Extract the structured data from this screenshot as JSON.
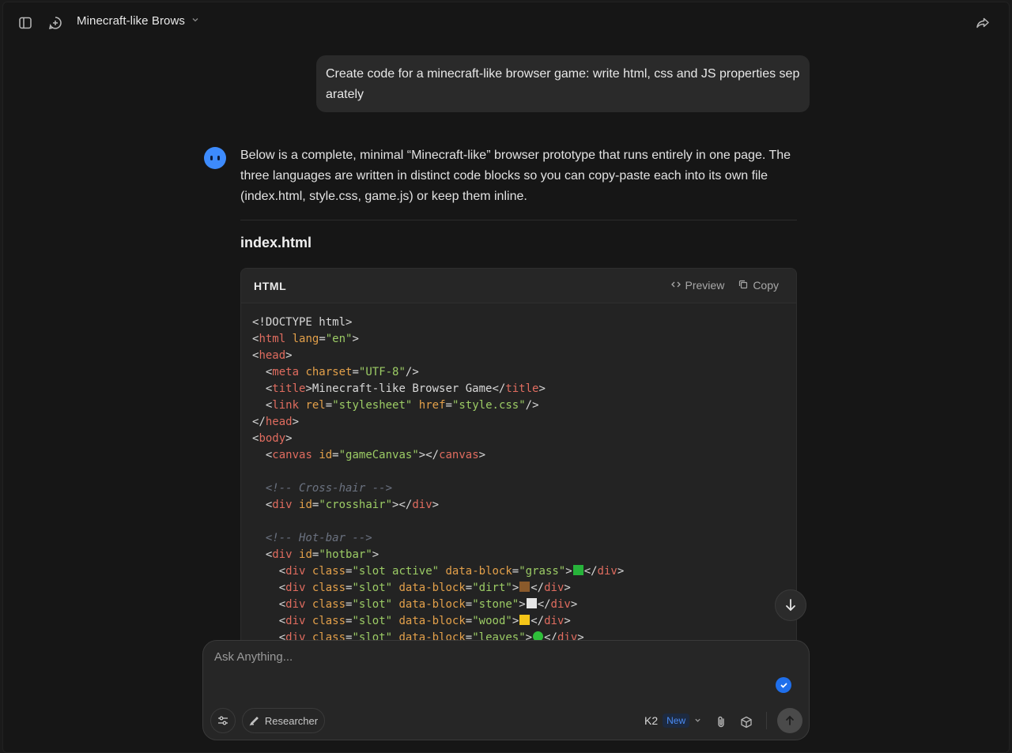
{
  "header": {
    "title": "Minecraft-like Brows",
    "sidebar_toggle_icon": "sidebar-toggle-icon",
    "new_chat_icon": "new-chat-icon",
    "share_icon": "share-icon"
  },
  "conversation": {
    "user_message": "Create code for a minecraft-like browser game: write html, css and JS properties separately",
    "assistant_intro": "Below is a complete, minimal “Minecraft-like” browser prototype that runs entirely in one page. The three languages are written in distinct code blocks so you can copy-paste each into its own file (index.html, style.css, game.js) or keep them inline.",
    "section_heading": "index.html"
  },
  "code_block": {
    "language": "HTML",
    "preview_label": "Preview",
    "copy_label": "Copy",
    "lines": [
      [
        [
          "pun",
          "<!DOCTYPE html>"
        ]
      ],
      [
        [
          "pun",
          "<"
        ],
        [
          "tag",
          "html"
        ],
        [
          "pun",
          " "
        ],
        [
          "attr",
          "lang"
        ],
        [
          "pun",
          "="
        ],
        [
          "str",
          "\"en\""
        ],
        [
          "pun",
          ">"
        ]
      ],
      [
        [
          "pun",
          "<"
        ],
        [
          "tag",
          "head"
        ],
        [
          "pun",
          ">"
        ]
      ],
      [
        [
          "pun",
          "  <"
        ],
        [
          "tag",
          "meta"
        ],
        [
          "pun",
          " "
        ],
        [
          "attr",
          "charset"
        ],
        [
          "pun",
          "="
        ],
        [
          "str",
          "\"UTF-8\""
        ],
        [
          "pun",
          "/>"
        ]
      ],
      [
        [
          "pun",
          "  <"
        ],
        [
          "tag",
          "title"
        ],
        [
          "pun",
          ">Minecraft-like Browser Game</"
        ],
        [
          "tag",
          "title"
        ],
        [
          "pun",
          ">"
        ]
      ],
      [
        [
          "pun",
          "  <"
        ],
        [
          "tag",
          "link"
        ],
        [
          "pun",
          " "
        ],
        [
          "attr",
          "rel"
        ],
        [
          "pun",
          "="
        ],
        [
          "str",
          "\"stylesheet\""
        ],
        [
          "pun",
          " "
        ],
        [
          "attr",
          "href"
        ],
        [
          "pun",
          "="
        ],
        [
          "str",
          "\"style.css\""
        ],
        [
          "pun",
          "/>"
        ]
      ],
      [
        [
          "pun",
          "</"
        ],
        [
          "tag",
          "head"
        ],
        [
          "pun",
          ">"
        ]
      ],
      [
        [
          "pun",
          "<"
        ],
        [
          "tag",
          "body"
        ],
        [
          "pun",
          ">"
        ]
      ],
      [
        [
          "pun",
          "  <"
        ],
        [
          "tag",
          "canvas"
        ],
        [
          "pun",
          " "
        ],
        [
          "attr",
          "id"
        ],
        [
          "pun",
          "="
        ],
        [
          "str",
          "\"gameCanvas\""
        ],
        [
          "pun",
          "></"
        ],
        [
          "tag",
          "canvas"
        ],
        [
          "pun",
          ">"
        ]
      ],
      [
        [
          "pun",
          ""
        ]
      ],
      [
        [
          "com",
          "  <!-- Cross-hair -->"
        ]
      ],
      [
        [
          "pun",
          "  <"
        ],
        [
          "tag",
          "div"
        ],
        [
          "pun",
          " "
        ],
        [
          "attr",
          "id"
        ],
        [
          "pun",
          "="
        ],
        [
          "str",
          "\"crosshair\""
        ],
        [
          "pun",
          "></"
        ],
        [
          "tag",
          "div"
        ],
        [
          "pun",
          ">"
        ]
      ],
      [
        [
          "pun",
          ""
        ]
      ],
      [
        [
          "com",
          "  <!-- Hot-bar -->"
        ]
      ],
      [
        [
          "pun",
          "  <"
        ],
        [
          "tag",
          "div"
        ],
        [
          "pun",
          " "
        ],
        [
          "attr",
          "id"
        ],
        [
          "pun",
          "="
        ],
        [
          "str",
          "\"hotbar\""
        ],
        [
          "pun",
          ">"
        ]
      ],
      [
        [
          "pun",
          "    <"
        ],
        [
          "tag",
          "div"
        ],
        [
          "pun",
          " "
        ],
        [
          "attr",
          "class"
        ],
        [
          "pun",
          "="
        ],
        [
          "str",
          "\"slot active\""
        ],
        [
          "pun",
          " "
        ],
        [
          "attr",
          "data-block"
        ],
        [
          "pun",
          "="
        ],
        [
          "str",
          "\"grass\""
        ],
        [
          "pun",
          ">"
        ],
        [
          "sq",
          "#27b33a"
        ],
        [
          "pun",
          "</"
        ],
        [
          "tag",
          "div"
        ],
        [
          "pun",
          ">"
        ]
      ],
      [
        [
          "pun",
          "    <"
        ],
        [
          "tag",
          "div"
        ],
        [
          "pun",
          " "
        ],
        [
          "attr",
          "class"
        ],
        [
          "pun",
          "="
        ],
        [
          "str",
          "\"slot\""
        ],
        [
          "pun",
          " "
        ],
        [
          "attr",
          "data-block"
        ],
        [
          "pun",
          "="
        ],
        [
          "str",
          "\"dirt\""
        ],
        [
          "pun",
          ">"
        ],
        [
          "sq",
          "#8a5a2b"
        ],
        [
          "pun",
          "</"
        ],
        [
          "tag",
          "div"
        ],
        [
          "pun",
          ">"
        ]
      ],
      [
        [
          "pun",
          "    <"
        ],
        [
          "tag",
          "div"
        ],
        [
          "pun",
          " "
        ],
        [
          "attr",
          "class"
        ],
        [
          "pun",
          "="
        ],
        [
          "str",
          "\"slot\""
        ],
        [
          "pun",
          " "
        ],
        [
          "attr",
          "data-block"
        ],
        [
          "pun",
          "="
        ],
        [
          "str",
          "\"stone\""
        ],
        [
          "pun",
          ">"
        ],
        [
          "sq",
          "#e6e6e6"
        ],
        [
          "pun",
          "</"
        ],
        [
          "tag",
          "div"
        ],
        [
          "pun",
          ">"
        ]
      ],
      [
        [
          "pun",
          "    <"
        ],
        [
          "tag",
          "div"
        ],
        [
          "pun",
          " "
        ],
        [
          "attr",
          "class"
        ],
        [
          "pun",
          "="
        ],
        [
          "str",
          "\"slot\""
        ],
        [
          "pun",
          " "
        ],
        [
          "attr",
          "data-block"
        ],
        [
          "pun",
          "="
        ],
        [
          "str",
          "\"wood\""
        ],
        [
          "pun",
          ">"
        ],
        [
          "sq",
          "#f5c518"
        ],
        [
          "pun",
          "</"
        ],
        [
          "tag",
          "div"
        ],
        [
          "pun",
          ">"
        ]
      ],
      [
        [
          "pun",
          "    <"
        ],
        [
          "tag",
          "div"
        ],
        [
          "pun",
          " "
        ],
        [
          "attr",
          "class"
        ],
        [
          "pun",
          "="
        ],
        [
          "str",
          "\"slot\""
        ],
        [
          "pun",
          " "
        ],
        [
          "attr",
          "data-block"
        ],
        [
          "pun",
          "="
        ],
        [
          "str",
          "\"leaves\""
        ],
        [
          "pun",
          ">"
        ],
        [
          "circ",
          "#2fbf3a"
        ],
        [
          "pun",
          "</"
        ],
        [
          "tag",
          "div"
        ],
        [
          "pun",
          ">"
        ]
      ]
    ]
  },
  "composer": {
    "placeholder": "Ask Anything...",
    "researcher_label": "Researcher",
    "model_name": "K2",
    "model_badge": "New",
    "accent_color": "#1f6feb"
  }
}
